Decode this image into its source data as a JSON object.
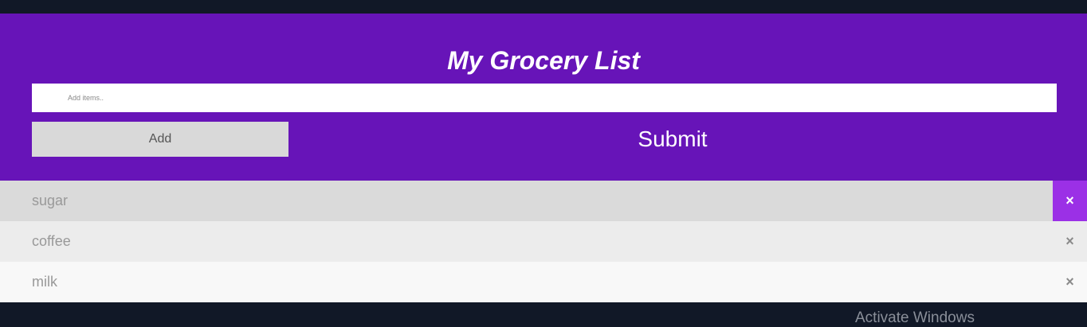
{
  "header": {
    "title": "My Grocery List",
    "input_placeholder": "Add items..",
    "input_value": "",
    "add_label": "Add",
    "submit_label": "Submit"
  },
  "items": [
    {
      "label": "sugar",
      "close_icon": "×"
    },
    {
      "label": "coffee",
      "close_icon": "×"
    },
    {
      "label": "milk",
      "close_icon": "×"
    }
  ],
  "watermark": "Activate Windows",
  "colors": {
    "header_bg": "#6714b8",
    "close_active_bg": "#9b30e6",
    "page_bg": "#111827"
  }
}
